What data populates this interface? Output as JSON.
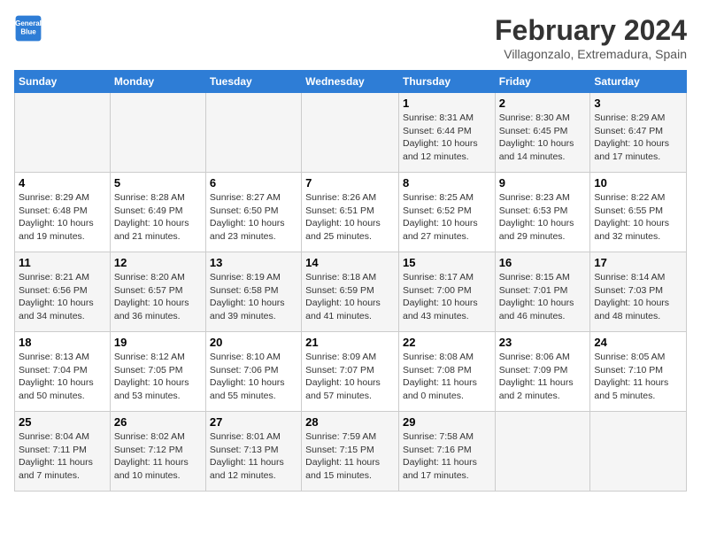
{
  "header": {
    "logo_line1": "General",
    "logo_line2": "Blue",
    "month_year": "February 2024",
    "location": "Villagonzalo, Extremadura, Spain"
  },
  "weekdays": [
    "Sunday",
    "Monday",
    "Tuesday",
    "Wednesday",
    "Thursday",
    "Friday",
    "Saturday"
  ],
  "weeks": [
    [
      {
        "day": "",
        "info": ""
      },
      {
        "day": "",
        "info": ""
      },
      {
        "day": "",
        "info": ""
      },
      {
        "day": "",
        "info": ""
      },
      {
        "day": "1",
        "info": "Sunrise: 8:31 AM\nSunset: 6:44 PM\nDaylight: 10 hours and 12 minutes."
      },
      {
        "day": "2",
        "info": "Sunrise: 8:30 AM\nSunset: 6:45 PM\nDaylight: 10 hours and 14 minutes."
      },
      {
        "day": "3",
        "info": "Sunrise: 8:29 AM\nSunset: 6:47 PM\nDaylight: 10 hours and 17 minutes."
      }
    ],
    [
      {
        "day": "4",
        "info": "Sunrise: 8:29 AM\nSunset: 6:48 PM\nDaylight: 10 hours and 19 minutes."
      },
      {
        "day": "5",
        "info": "Sunrise: 8:28 AM\nSunset: 6:49 PM\nDaylight: 10 hours and 21 minutes."
      },
      {
        "day": "6",
        "info": "Sunrise: 8:27 AM\nSunset: 6:50 PM\nDaylight: 10 hours and 23 minutes."
      },
      {
        "day": "7",
        "info": "Sunrise: 8:26 AM\nSunset: 6:51 PM\nDaylight: 10 hours and 25 minutes."
      },
      {
        "day": "8",
        "info": "Sunrise: 8:25 AM\nSunset: 6:52 PM\nDaylight: 10 hours and 27 minutes."
      },
      {
        "day": "9",
        "info": "Sunrise: 8:23 AM\nSunset: 6:53 PM\nDaylight: 10 hours and 29 minutes."
      },
      {
        "day": "10",
        "info": "Sunrise: 8:22 AM\nSunset: 6:55 PM\nDaylight: 10 hours and 32 minutes."
      }
    ],
    [
      {
        "day": "11",
        "info": "Sunrise: 8:21 AM\nSunset: 6:56 PM\nDaylight: 10 hours and 34 minutes."
      },
      {
        "day": "12",
        "info": "Sunrise: 8:20 AM\nSunset: 6:57 PM\nDaylight: 10 hours and 36 minutes."
      },
      {
        "day": "13",
        "info": "Sunrise: 8:19 AM\nSunset: 6:58 PM\nDaylight: 10 hours and 39 minutes."
      },
      {
        "day": "14",
        "info": "Sunrise: 8:18 AM\nSunset: 6:59 PM\nDaylight: 10 hours and 41 minutes."
      },
      {
        "day": "15",
        "info": "Sunrise: 8:17 AM\nSunset: 7:00 PM\nDaylight: 10 hours and 43 minutes."
      },
      {
        "day": "16",
        "info": "Sunrise: 8:15 AM\nSunset: 7:01 PM\nDaylight: 10 hours and 46 minutes."
      },
      {
        "day": "17",
        "info": "Sunrise: 8:14 AM\nSunset: 7:03 PM\nDaylight: 10 hours and 48 minutes."
      }
    ],
    [
      {
        "day": "18",
        "info": "Sunrise: 8:13 AM\nSunset: 7:04 PM\nDaylight: 10 hours and 50 minutes."
      },
      {
        "day": "19",
        "info": "Sunrise: 8:12 AM\nSunset: 7:05 PM\nDaylight: 10 hours and 53 minutes."
      },
      {
        "day": "20",
        "info": "Sunrise: 8:10 AM\nSunset: 7:06 PM\nDaylight: 10 hours and 55 minutes."
      },
      {
        "day": "21",
        "info": "Sunrise: 8:09 AM\nSunset: 7:07 PM\nDaylight: 10 hours and 57 minutes."
      },
      {
        "day": "22",
        "info": "Sunrise: 8:08 AM\nSunset: 7:08 PM\nDaylight: 11 hours and 0 minutes."
      },
      {
        "day": "23",
        "info": "Sunrise: 8:06 AM\nSunset: 7:09 PM\nDaylight: 11 hours and 2 minutes."
      },
      {
        "day": "24",
        "info": "Sunrise: 8:05 AM\nSunset: 7:10 PM\nDaylight: 11 hours and 5 minutes."
      }
    ],
    [
      {
        "day": "25",
        "info": "Sunrise: 8:04 AM\nSunset: 7:11 PM\nDaylight: 11 hours and 7 minutes."
      },
      {
        "day": "26",
        "info": "Sunrise: 8:02 AM\nSunset: 7:12 PM\nDaylight: 11 hours and 10 minutes."
      },
      {
        "day": "27",
        "info": "Sunrise: 8:01 AM\nSunset: 7:13 PM\nDaylight: 11 hours and 12 minutes."
      },
      {
        "day": "28",
        "info": "Sunrise: 7:59 AM\nSunset: 7:15 PM\nDaylight: 11 hours and 15 minutes."
      },
      {
        "day": "29",
        "info": "Sunrise: 7:58 AM\nSunset: 7:16 PM\nDaylight: 11 hours and 17 minutes."
      },
      {
        "day": "",
        "info": ""
      },
      {
        "day": "",
        "info": ""
      }
    ]
  ]
}
